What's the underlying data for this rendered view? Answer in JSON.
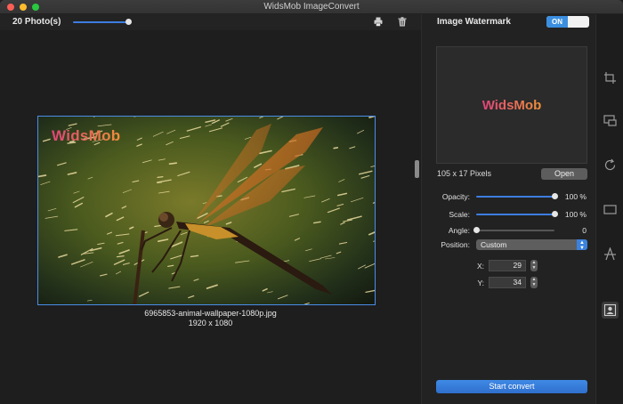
{
  "window": {
    "title": "WidsMob ImageConvert"
  },
  "toolbar": {
    "photo_count": "20 Photo(s)",
    "zoom_level": 0.95,
    "icons": [
      "printer-icon",
      "trash-icon"
    ]
  },
  "preview": {
    "file_name": "6965853-animal-wallpaper-1080p.jpg",
    "dimensions": "1920 x 1080",
    "watermark_text": "WidsMob"
  },
  "watermark_panel": {
    "title": "Image Watermark",
    "toggle_label": "ON",
    "logo_text": "WidsMob",
    "size_text": "105 x 17 Pixels",
    "open_label": "Open",
    "opacity": {
      "label": "Opacity:",
      "value": "100 %",
      "level": 1.0
    },
    "scale": {
      "label": "Scale:",
      "value": "100 %",
      "level": 1.0
    },
    "angle": {
      "label": "Angle:",
      "value": "0",
      "level": 0.0
    },
    "position": {
      "label": "Position:",
      "selected": "Custom"
    },
    "x": {
      "label": "X:",
      "value": "29"
    },
    "y": {
      "label": "Y:",
      "value": "34"
    },
    "start_label": "Start convert"
  },
  "side_strip": {
    "icons": [
      "crop-icon",
      "resize-icon",
      "rotate-icon",
      "border-icon",
      "text-watermark-icon",
      "image-watermark-icon"
    ],
    "active": "image-watermark-icon"
  },
  "colors": {
    "accent": "#3b8fe0",
    "watermark_pink": "#e0447a",
    "watermark_orange": "#f0913a"
  }
}
